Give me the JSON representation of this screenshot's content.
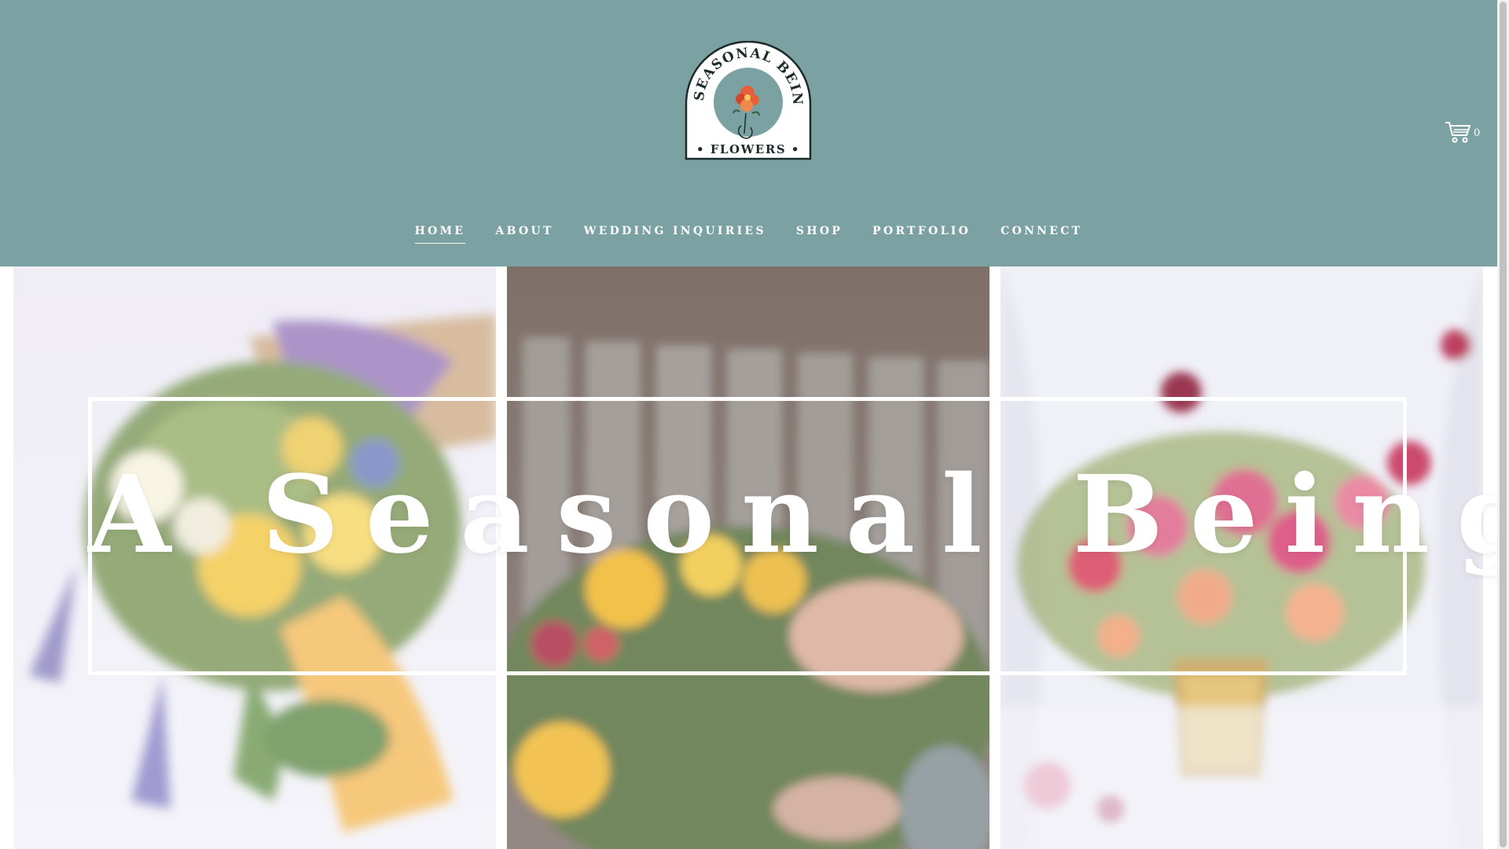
{
  "brand": {
    "logo_text_top": "A SEASONAL BEING",
    "logo_text_bottom": "FLOWERS",
    "header_color": "#7ba1a2"
  },
  "cart": {
    "icon": "cart-icon",
    "count": "0"
  },
  "nav": {
    "items": [
      {
        "label": "HOME",
        "active": true
      },
      {
        "label": "ABOUT"
      },
      {
        "label": "WEDDING INQUIRIES"
      },
      {
        "label": "SHOP"
      },
      {
        "label": "PORTFOLIO"
      },
      {
        "label": "CONNECT"
      }
    ]
  },
  "hero": {
    "title": "A Seasonal Being"
  }
}
